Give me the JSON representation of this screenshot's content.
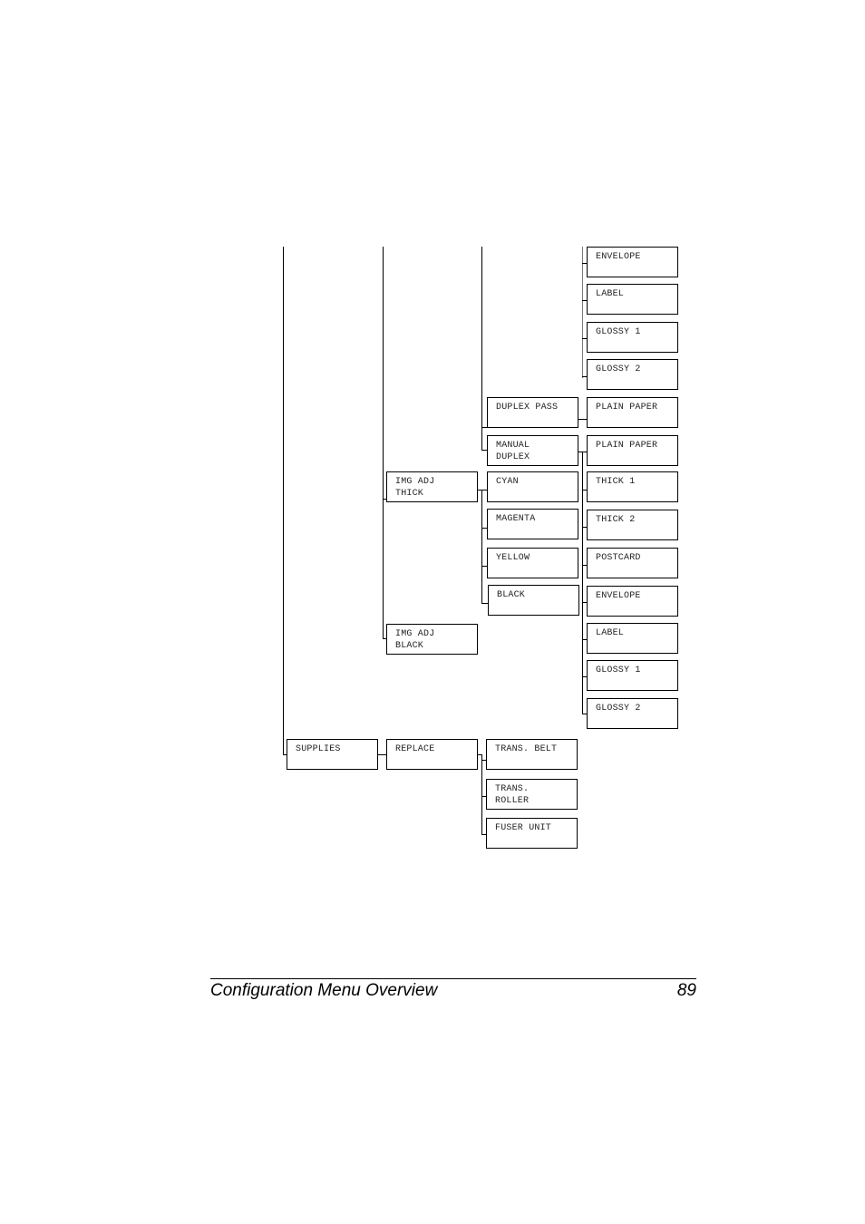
{
  "diagram": {
    "col4_top": [
      "ENVELOPE",
      "LABEL",
      "GLOSSY 1",
      "GLOSSY 2"
    ],
    "duplex_pass": {
      "label": "DUPLEX PASS",
      "child": "PLAIN PAPER"
    },
    "manual_duplex": {
      "label": "MANUAL\nDUPLEX",
      "children": [
        "PLAIN PAPER",
        "THICK 1",
        "THICK 2",
        "POSTCARD",
        "ENVELOPE",
        "LABEL",
        "GLOSSY 1",
        "GLOSSY 2"
      ]
    },
    "img_adj_thick": {
      "label": "IMG ADJ\nTHICK",
      "children": [
        "CYAN",
        "MAGENTA",
        "YELLOW",
        "BLACK"
      ]
    },
    "img_adj_black": {
      "label": "IMG ADJ\nBLACK"
    },
    "supplies": {
      "label": "SUPPLIES",
      "replace": {
        "label": "REPLACE",
        "children": [
          "TRANS. BELT",
          "TRANS.\nROLLER",
          "FUSER UNIT"
        ]
      }
    }
  },
  "footer": {
    "title": "Configuration Menu Overview",
    "page_number": "89"
  }
}
